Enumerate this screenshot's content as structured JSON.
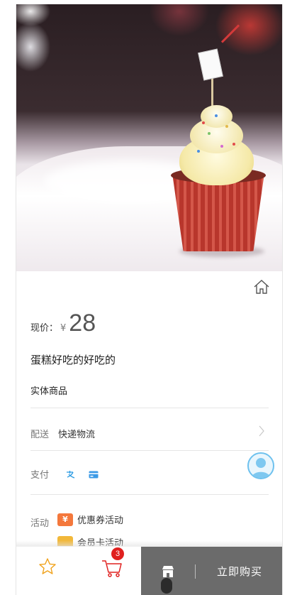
{
  "product": {
    "image_alt": "cupcake-photo",
    "price_label": "现价：",
    "currency": "¥",
    "price": "28",
    "title": "蛋糕好吃的好吃的",
    "type": "实体商品"
  },
  "shipping": {
    "label": "配送",
    "value": "快递物流"
  },
  "payment": {
    "label": "支付",
    "icons": [
      "alipay-icon",
      "card-icon"
    ]
  },
  "activities": {
    "label": "活动",
    "items": [
      {
        "label": "优惠券活动",
        "icon": "coupon-icon",
        "color": "#f4783c"
      },
      {
        "label": "会员卡活动",
        "icon": "membership-card-icon",
        "color": "#f2b83a"
      }
    ]
  },
  "bottom_bar": {
    "favorite_icon": "star-icon",
    "cart_icon": "cart-icon",
    "cart_count": "3",
    "shop_icon": "store-icon",
    "buy_label": "立即购买"
  },
  "colors": {
    "accent_red": "#e0201f",
    "star": "#f0a21c",
    "panel": "#6b6b6b",
    "avatar_ring": "#6ec1ee"
  }
}
